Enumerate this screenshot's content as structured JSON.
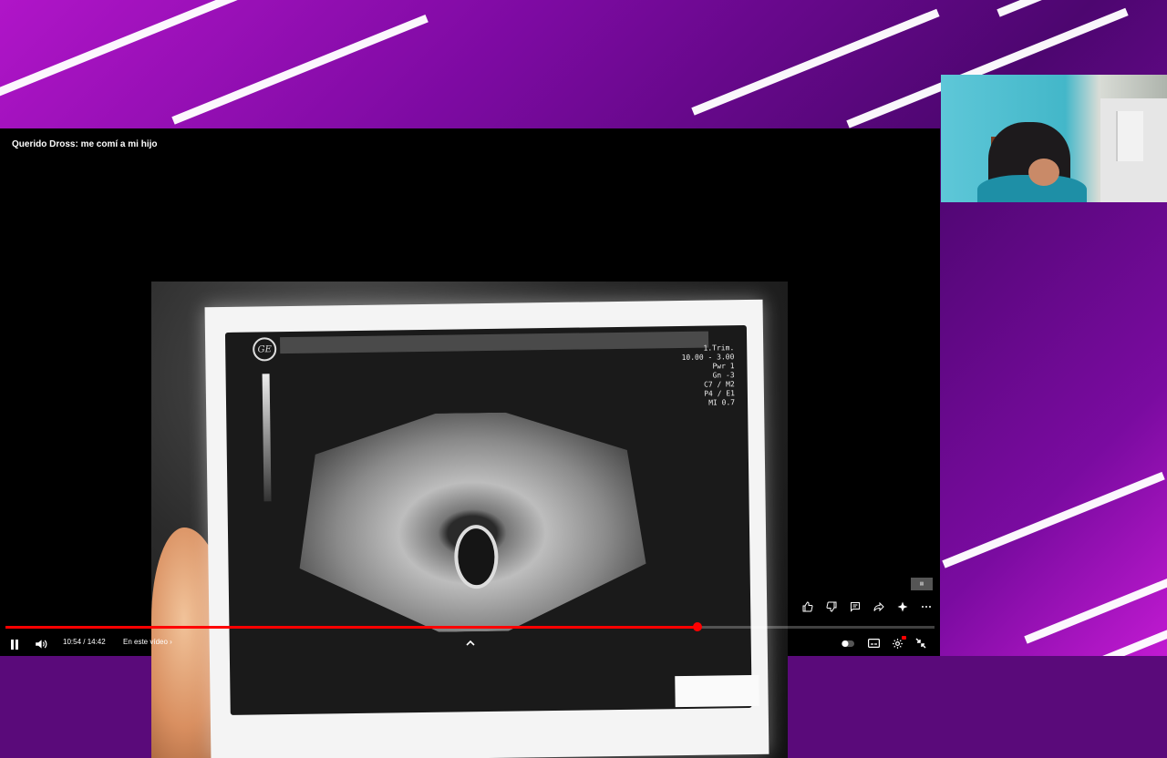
{
  "video": {
    "title": "Querido Dross: me comí a mi hijo",
    "time_display": "10:54 / 14:42",
    "chapter_label": "En este vídeo",
    "progress": 0.745
  },
  "ultrasound": {
    "readout": [
      "1.Trim.",
      "10.00 - 3.00",
      "Pwr  1",
      "Gn  -3",
      "C7 / M2",
      "P4 / E1",
      "MI  0.7"
    ]
  },
  "overlay_icons": [
    "like-icon",
    "dislike-icon",
    "comment-icon",
    "share-icon",
    "remix-icon",
    "more-icon"
  ],
  "control_icons": [
    "pause-icon",
    "volume-icon",
    "chevron-up-icon",
    "autoplay-icon",
    "subtitles-icon",
    "settings-icon",
    "exit-fullscreen-icon"
  ],
  "colors": {
    "accent": "#ff0000",
    "background_purple": "#7d0aa2"
  }
}
